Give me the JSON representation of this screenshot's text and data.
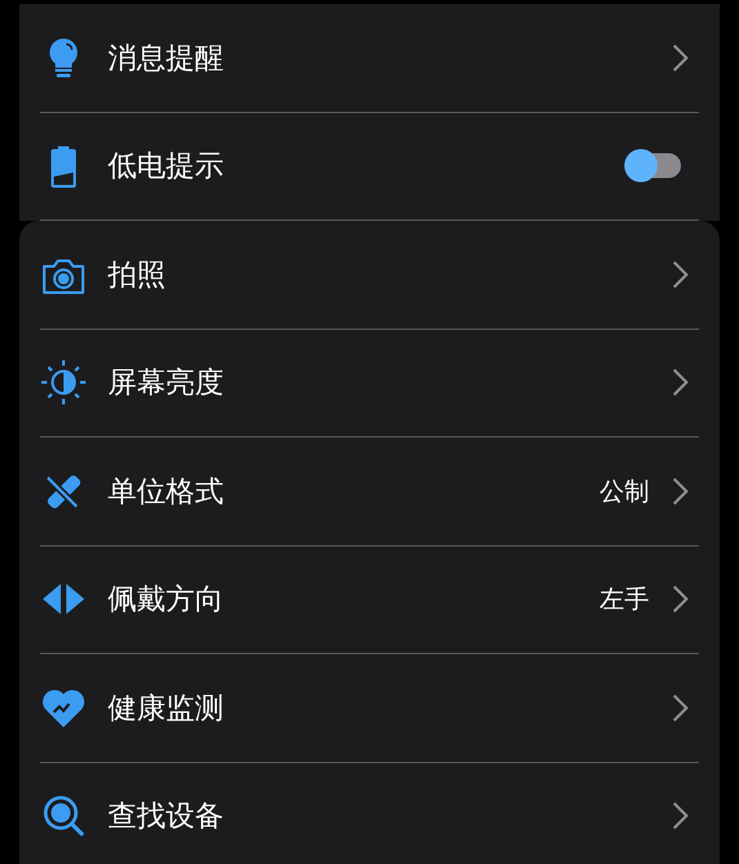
{
  "groups": [
    {
      "items": [
        {
          "kind": "link",
          "label": "消息提醒"
        },
        {
          "kind": "toggle",
          "label": "低电提示",
          "on": false
        }
      ]
    },
    {
      "items": [
        {
          "kind": "link",
          "label": "拍照"
        },
        {
          "kind": "link",
          "label": "屏幕亮度"
        },
        {
          "kind": "link",
          "label": "单位格式",
          "value": "公制"
        },
        {
          "kind": "link",
          "label": "佩戴方向",
          "value": "左手"
        },
        {
          "kind": "link",
          "label": "健康监测"
        },
        {
          "kind": "link",
          "label": "查找设备"
        }
      ]
    }
  ]
}
